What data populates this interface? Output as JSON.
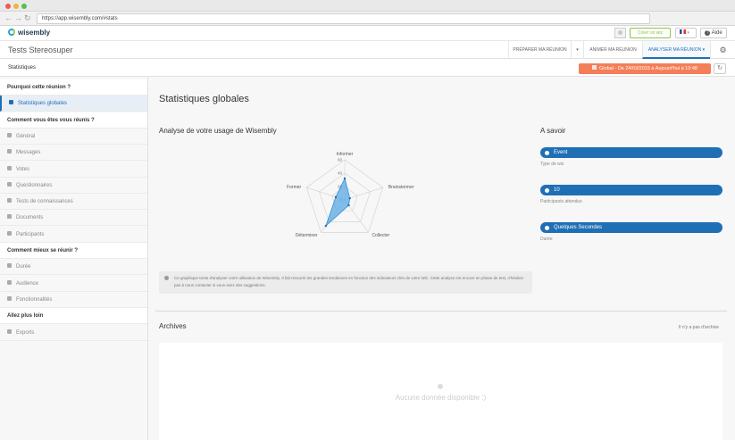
{
  "browser": {
    "url": "https://app.wisembly.com/#stats",
    "dot_colors": [
      "#ee5b53",
      "#f2b33c",
      "#55c04a"
    ]
  },
  "header": {
    "logo_text": "wisembly",
    "create_button": "Créer un wiz",
    "language": "FR",
    "help_button": "Aide"
  },
  "subheader": {
    "room_title": "Tests Stereosuper",
    "tabs": [
      "PRÉPARER MA RÉUNION",
      "ANIMER MA RÉUNION",
      "ANALYSER MA RÉUNION"
    ]
  },
  "breadcrumb": {
    "label": "Statistiques",
    "date_range": "Global - De 24/03/2015 à Aujourd'hui à 10:48"
  },
  "sidebar": {
    "sections": [
      {
        "title": "Pourquoi cette réunion ?",
        "items": [
          {
            "label": "Statistiques globales",
            "icon": "bar-chart-icon",
            "active": true
          }
        ]
      },
      {
        "title": "Comment vous êtes vous réunis ?",
        "items": [
          {
            "label": "Général",
            "icon": "document-icon"
          },
          {
            "label": "Messages",
            "icon": "messages-icon"
          },
          {
            "label": "Votes",
            "icon": "vote-chart-icon"
          },
          {
            "label": "Questionnaires",
            "icon": "questionnaire-icon"
          },
          {
            "label": "Tests de connaissances",
            "icon": "upload-icon"
          },
          {
            "label": "Documents",
            "icon": "documents-icon"
          },
          {
            "label": "Participants",
            "icon": "user-icon"
          }
        ]
      },
      {
        "title": "Comment mieux se réunir ?",
        "items": [
          {
            "label": "Durée",
            "icon": "clock-icon"
          },
          {
            "label": "Audience",
            "icon": "audience-icon"
          },
          {
            "label": "Fonctionnalités",
            "icon": "tag-icon"
          }
        ]
      },
      {
        "title": "Allez plus loin",
        "items": [
          {
            "label": "Exports",
            "icon": "cloud-download-icon"
          }
        ]
      }
    ]
  },
  "main": {
    "title": "Statistiques globales",
    "analysis_title": "Analyse de votre usage de Wisembly",
    "info_text": "Ce graphique tente d'analyser votre utilisation de Wisembly. Il fait ressortir les grandes tendances en fonction des indicateurs clés de votre Wiz. Cette analyse est encore en phase de test, n'hésitez pas à nous contacter si vous avez des suggestions.",
    "a_savoir": {
      "title": "A savoir",
      "items": [
        {
          "value": "Event",
          "caption": "Type de wiz",
          "icon": "user-icon"
        },
        {
          "value": "10",
          "caption": "Participants attendus",
          "icon": "user-icon"
        },
        {
          "value": "Quelques Secondes",
          "caption": "Durée",
          "icon": "clock-icon"
        }
      ]
    },
    "archives": {
      "title": "Archives",
      "note": "Il n'y a pas d'archive",
      "empty_text": "Aucune donnée disponible :)"
    }
  },
  "chart_data": {
    "type": "radar",
    "axes": [
      "Informer",
      "Brainstormer",
      "Collecter",
      "Déterminer",
      "Former"
    ],
    "values": [
      32,
      8,
      10,
      48,
      14
    ],
    "ticks": [
      0,
      20,
      40,
      60
    ],
    "max": 60,
    "color": "#5aaae3"
  }
}
